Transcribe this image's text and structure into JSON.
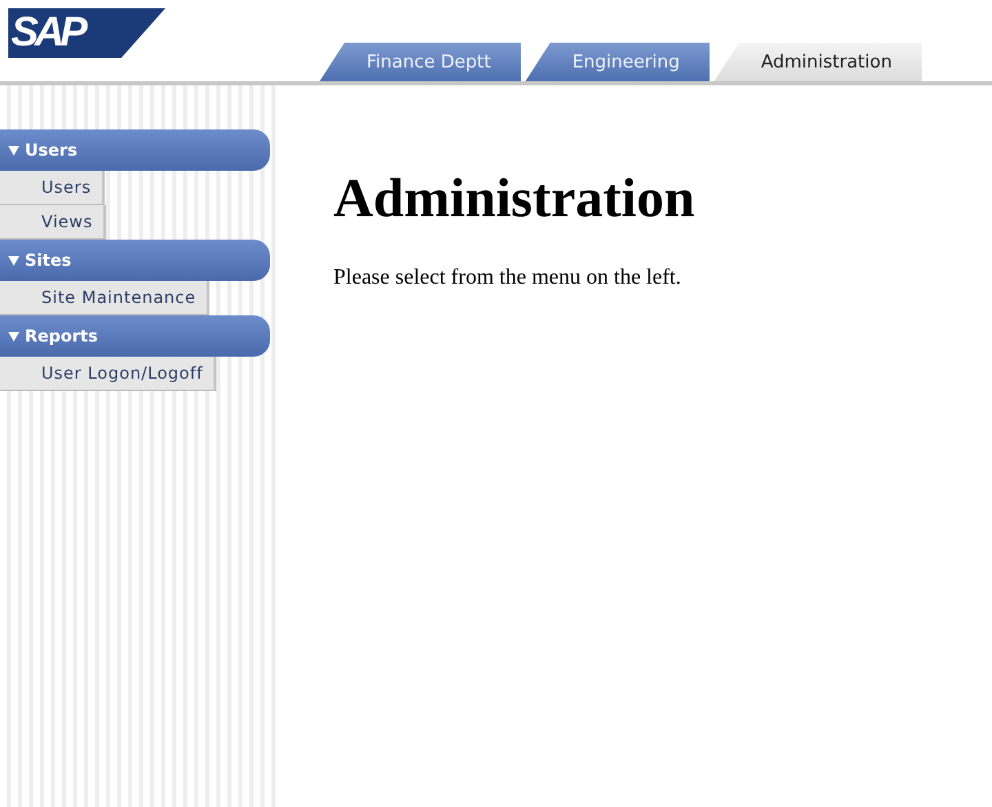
{
  "logo": {
    "text": "SAP"
  },
  "tabs": [
    {
      "label": "Finance Deptt",
      "selected": false
    },
    {
      "label": "Engineering",
      "selected": false
    },
    {
      "label": "Administration",
      "selected": true
    }
  ],
  "sidebar": {
    "sections": [
      {
        "title": "Users",
        "expanded": true,
        "items": [
          {
            "label": "Users"
          },
          {
            "label": "Views"
          }
        ]
      },
      {
        "title": "Sites",
        "expanded": true,
        "items": [
          {
            "label": "Site Maintenance"
          }
        ]
      },
      {
        "title": "Reports",
        "expanded": true,
        "items": [
          {
            "label": "User Logon/Logoff"
          }
        ]
      }
    ]
  },
  "content": {
    "heading": "Administration",
    "text": "Please select from the menu on the left."
  }
}
